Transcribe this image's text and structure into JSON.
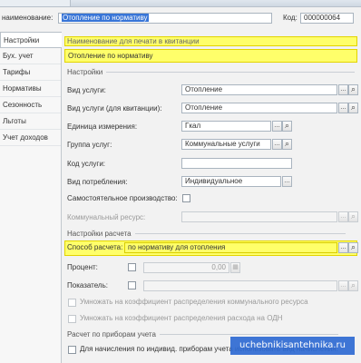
{
  "header": {
    "name_label": "наименование:",
    "name_value": "Отопление по нормативу",
    "code_label": "Код:",
    "code_value": "000000064"
  },
  "sidebar": {
    "items": [
      {
        "label": "Настройки",
        "active": true
      },
      {
        "label": "Бух. учет"
      },
      {
        "label": "Тарифы"
      },
      {
        "label": "Нормативы"
      },
      {
        "label": "Сезонность"
      },
      {
        "label": "Льготы"
      },
      {
        "label": "Учет доходов"
      }
    ]
  },
  "print_section": {
    "title": "Наименование  для печати в квитанции",
    "value": "Отопление по нормативу"
  },
  "settings": {
    "title": "Настройки",
    "service_type_label": "Вид услуги:",
    "service_type_value": "Отопление",
    "service_type_receipt_label": "Вид услуги (для квитанции):",
    "service_type_receipt_value": "Отопление",
    "unit_label": "Единица измерения:",
    "unit_value": "Гкал",
    "group_label": "Группа услуг:",
    "group_value": "Коммунальные услуги",
    "code_label": "Код услуги:",
    "code_value": "",
    "consumption_label": "Вид потребления:",
    "consumption_value": "Индивидуальное",
    "self_production_label": "Самостоятельное производство:",
    "communal_resource_label": "Коммунальный ресурс:",
    "communal_resource_value": ""
  },
  "calc": {
    "title": "Настройки расчета",
    "method_label": "Способ расчета:",
    "method_value": "по нормативу для отопления",
    "percent_label": "Процент:",
    "percent_value": "0,00",
    "indicator_label": "Показатель:",
    "multiply_communal": "Умножать на коэффициент распределения коммунального ресурса",
    "multiply_odn": "Умножать на коэффициент распределения расхода на ОДН"
  },
  "meters": {
    "title": "Расчет по приборам учета",
    "individual_label": "Для начисления по индивид. приборам учета использовать вид начисления:"
  },
  "watermark": "uchebnikisantehnika.ru",
  "icons": {
    "select": "ellipsis-icon",
    "search": "magnifier-icon",
    "calc": "calculator-icon"
  }
}
